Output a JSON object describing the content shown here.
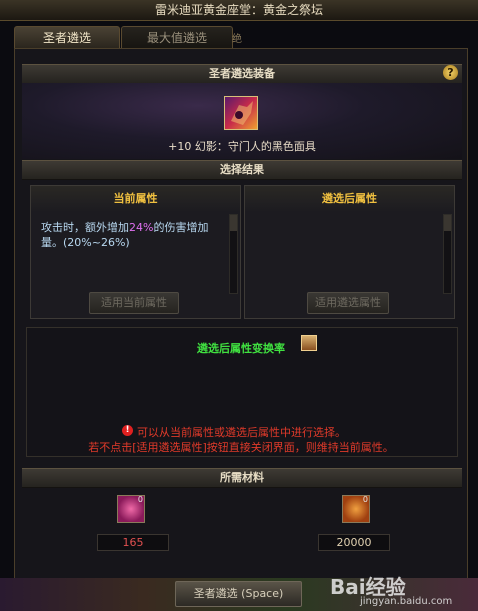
{
  "window": {
    "title": "雷米迪亚黄金座堂：黄金之祭坛"
  },
  "tabs": [
    {
      "label": "圣者遴选",
      "active": true
    },
    {
      "label": "最大值遴选",
      "active": false
    }
  ],
  "tab_extra": "绝",
  "equip_section": {
    "header": "圣者遴选装备",
    "help_icon": "?",
    "item_name": "+10 幻影：守门人的黑色面具"
  },
  "result_section": {
    "header": "选择结果",
    "current": {
      "title": "当前属性",
      "text_pre": "攻击时，额外增加",
      "text_highlight": "24%",
      "text_post": "的伤害增加量。(20%~26%)",
      "button": "适用当前属性"
    },
    "after": {
      "title": "遴选后属性",
      "button": "适用遴选属性"
    }
  },
  "conversion": {
    "title": "遴选后属性变换率",
    "warn_icon": "!",
    "note_line1": "可以从当前属性或遴选后属性中进行选择。",
    "note_line2": "若不点击[适用遴选属性]按钮直接关闭界面，则维持当前属性。"
  },
  "materials": {
    "header": "所需材料",
    "items": [
      {
        "icon": "orb-icon",
        "badge": "0",
        "count": "165"
      },
      {
        "icon": "gold-ore-icon",
        "badge": "0",
        "count": "20000"
      }
    ]
  },
  "footer": {
    "button": "圣者遴选 (Space)"
  },
  "watermark": {
    "brand": "Bai经验",
    "url": "jingyan.baidu.com"
  },
  "colors": {
    "attr_title": "#f0c040",
    "conversion_title": "#40e040",
    "warning_text": "#e03a2a",
    "insufficient_count": "#e05050"
  }
}
